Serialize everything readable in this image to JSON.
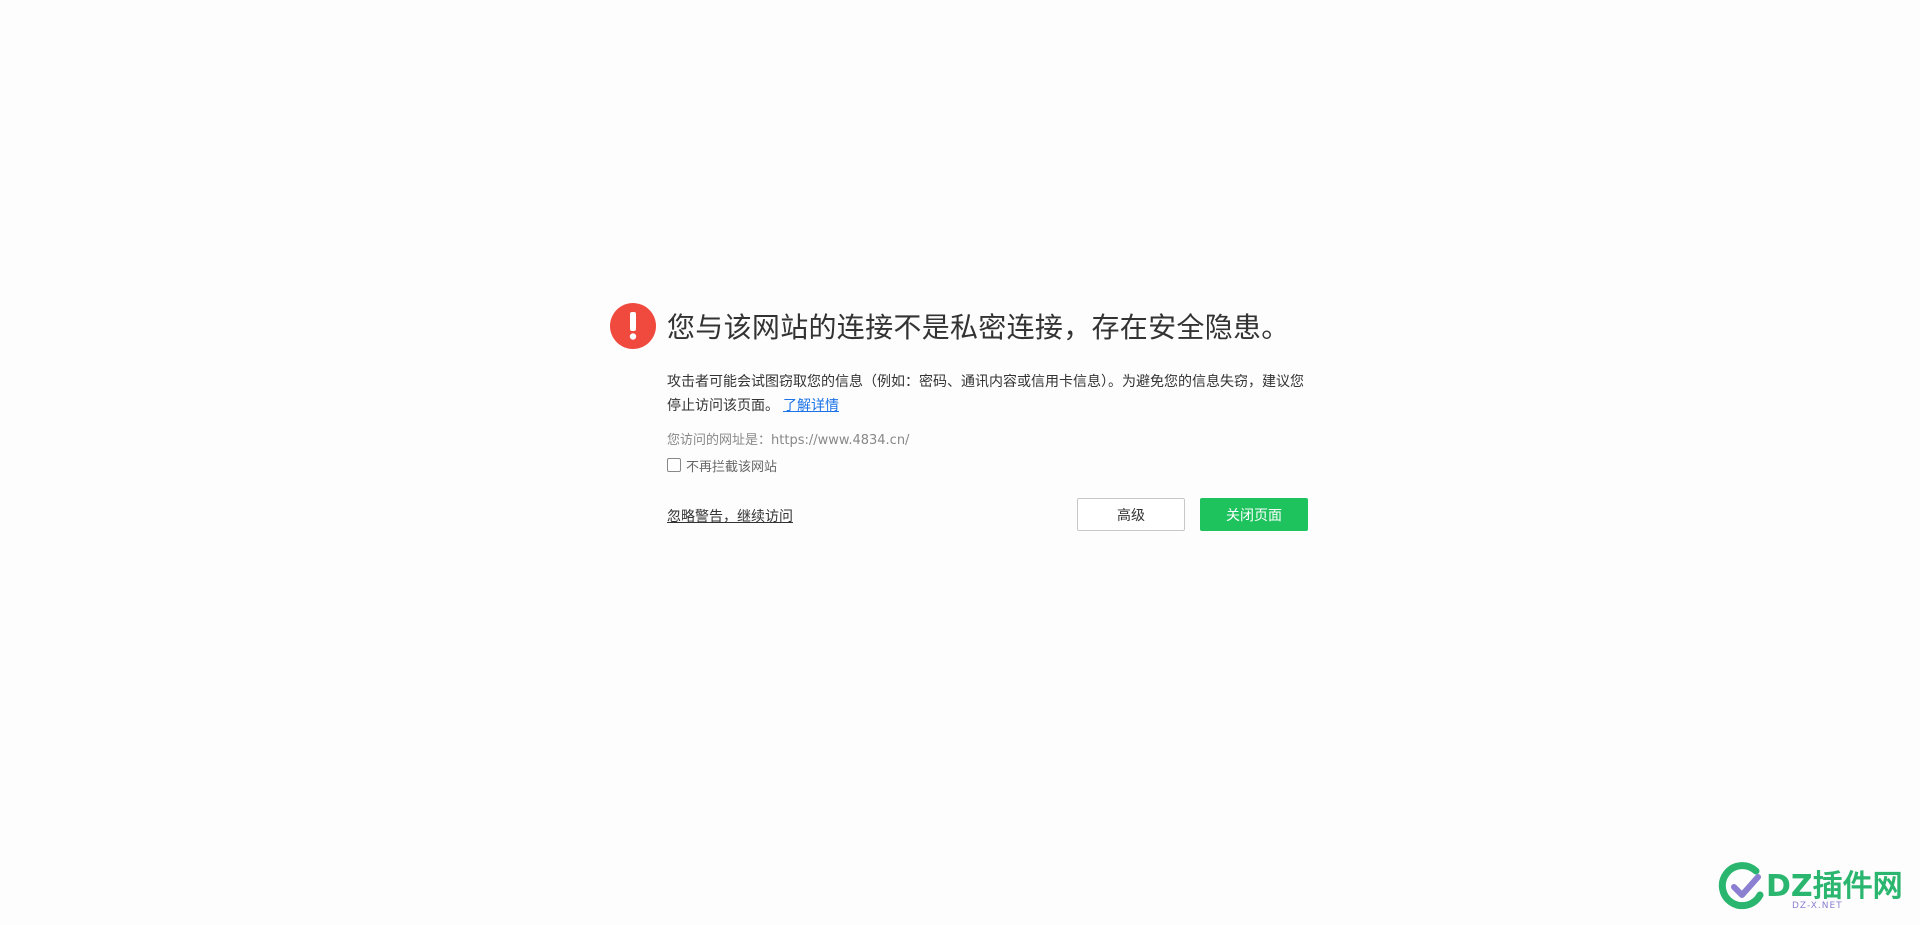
{
  "warning": {
    "title": "您与该网站的连接不是私密连接，存在安全隐患。",
    "description": "攻击者可能会试图窃取您的信息（例如：密码、通讯内容或信用卡信息）。为避免您的信息失窃，建议您停止访问该页面。",
    "learn_more_label": "了解详情",
    "visited_url_label": "您访问的网址是：",
    "visited_url": "https://www.4834.cn/",
    "dont_block_label": "不再拦截该网站"
  },
  "actions": {
    "ignore_label": "忽略警告，继续访问",
    "advanced_label": "高级",
    "close_label": "关闭页面"
  },
  "watermark": {
    "brand": "DZ插件网",
    "sub": "DZ-X.NET"
  },
  "colors": {
    "alert_red": "#f0493e",
    "primary_green": "#1ec35e",
    "link_blue": "#1a73e8"
  }
}
